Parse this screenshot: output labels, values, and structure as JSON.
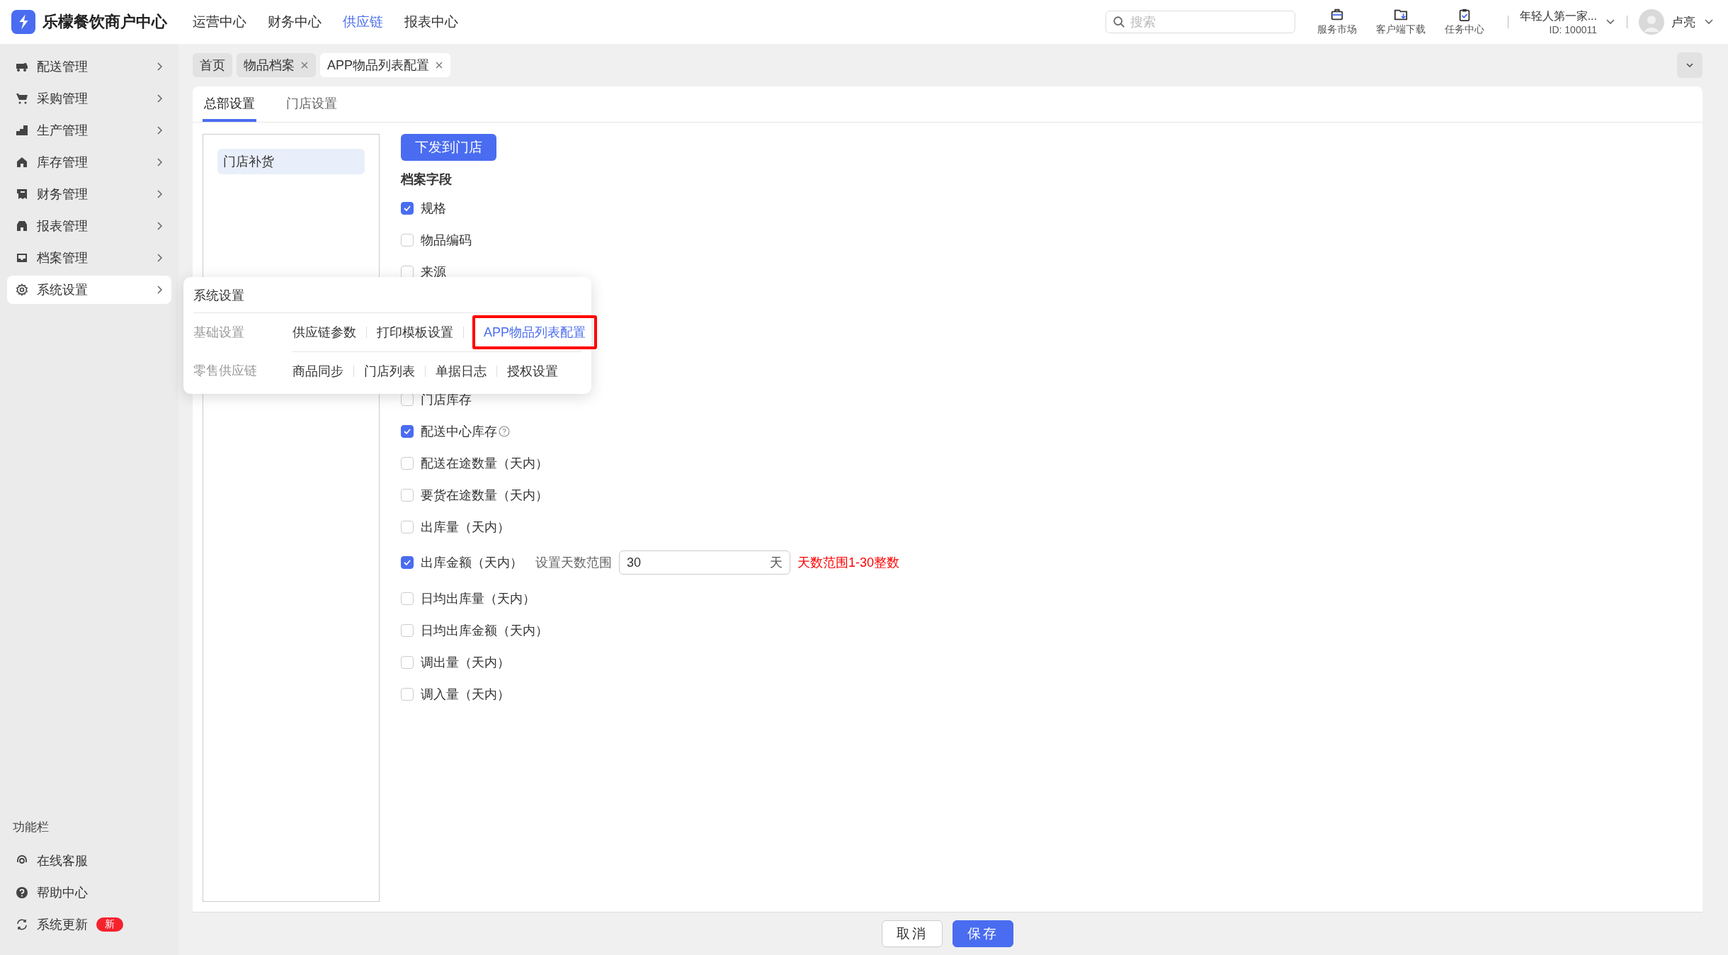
{
  "app": {
    "name": "乐檬餐饮商户中心"
  },
  "top_nav": [
    {
      "label": "运营中心",
      "selected": false
    },
    {
      "label": "财务中心",
      "selected": false
    },
    {
      "label": "供应链",
      "selected": true
    },
    {
      "label": "报表中心",
      "selected": false
    }
  ],
  "search": {
    "placeholder": "搜索"
  },
  "toolbar": [
    {
      "label": "服务市场",
      "kind": "market"
    },
    {
      "label": "客户端下载",
      "kind": "download"
    },
    {
      "label": "任务中心",
      "kind": "tasks"
    }
  ],
  "account": {
    "name": "年轻人第一家...",
    "id": "ID: 100011"
  },
  "user": {
    "name": "卢亮"
  },
  "sidebar": {
    "items": [
      {
        "label": "配送管理",
        "kind": "truck",
        "selected": false
      },
      {
        "label": "采购管理",
        "kind": "cart",
        "selected": false
      },
      {
        "label": "生产管理",
        "kind": "steps",
        "selected": false
      },
      {
        "label": "库存管理",
        "kind": "house",
        "selected": false
      },
      {
        "label": "财务管理",
        "kind": "ledger",
        "selected": false
      },
      {
        "label": "报表管理",
        "kind": "shop",
        "selected": false
      },
      {
        "label": "档案管理",
        "kind": "tray",
        "selected": false
      },
      {
        "label": "系统设置",
        "kind": "gear",
        "selected": true
      }
    ],
    "footer_title": "功能栏",
    "footer_items": [
      {
        "label": "在线客服",
        "kind": "headset"
      },
      {
        "label": "帮助中心",
        "kind": "help"
      },
      {
        "label": "系统更新",
        "kind": "refresh",
        "badge": "新"
      }
    ]
  },
  "page_tabs": [
    {
      "label": "首页",
      "closable": false,
      "selected": false
    },
    {
      "label": "物品档案",
      "closable": true,
      "selected": false
    },
    {
      "label": "APP物品列表配置",
      "closable": true,
      "selected": true
    }
  ],
  "content_tabs": [
    {
      "label": "总部设置",
      "selected": true
    },
    {
      "label": "门店设置",
      "selected": false
    }
  ],
  "categories": [
    {
      "label": "门店补货",
      "selected": true
    }
  ],
  "push_button": "下发到门店",
  "section_title": "档案字段",
  "fields_above": [
    {
      "label": "规格",
      "checked": true
    },
    {
      "label": "物品编码",
      "checked": false
    },
    {
      "label": "来源",
      "checked": false
    }
  ],
  "fields_below": [
    {
      "label": "门店库存",
      "checked": false
    },
    {
      "label": "配送中心库存",
      "checked": true,
      "help": true
    },
    {
      "label": "配送在途数量（天内）",
      "checked": false
    },
    {
      "label": "要货在途数量（天内）",
      "checked": false
    },
    {
      "label": "出库量（天内）",
      "checked": false
    },
    {
      "label": "出库金额（天内）",
      "checked": true,
      "range": {
        "label": "设置天数范围",
        "value": "30",
        "unit": "天",
        "hint": "天数范围1-30整数"
      }
    },
    {
      "label": "日均出库量（天内）",
      "checked": false
    },
    {
      "label": "日均出库金额（天内）",
      "checked": false
    },
    {
      "label": "调出量（天内）",
      "checked": false
    },
    {
      "label": "调入量（天内）",
      "checked": false
    }
  ],
  "flyout": {
    "title": "系统设置",
    "groups": [
      {
        "label": "基础设置",
        "links": [
          {
            "label": "供应链参数",
            "selected": false
          },
          {
            "label": "打印模板设置",
            "selected": false
          },
          {
            "label": "APP物品列表配置",
            "selected": true
          }
        ]
      },
      {
        "label": "零售供应链",
        "links": [
          {
            "label": "商品同步",
            "selected": false
          },
          {
            "label": "门店列表",
            "selected": false
          },
          {
            "label": "单据日志",
            "selected": false
          },
          {
            "label": "授权设置",
            "selected": false
          }
        ]
      }
    ]
  },
  "footer_buttons": [
    {
      "label": "取消",
      "kind": "secondary"
    },
    {
      "label": "保存",
      "kind": "primary"
    }
  ]
}
